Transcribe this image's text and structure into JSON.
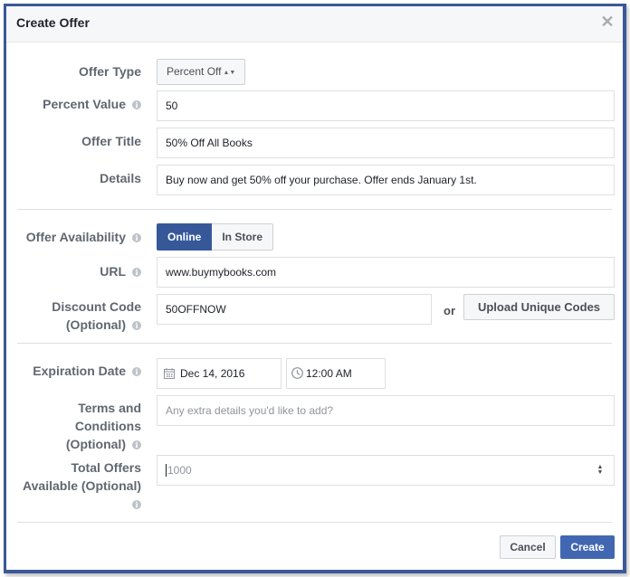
{
  "dialog": {
    "title": "Create Offer",
    "close_icon": "close-icon"
  },
  "form": {
    "offer_type": {
      "label": "Offer Type",
      "value": "Percent Off",
      "icon": "updown-arrows-icon"
    },
    "percent_value": {
      "label": "Percent Value",
      "value": "50",
      "info_icon": "info-icon"
    },
    "offer_title": {
      "label": "Offer Title",
      "value": "50% Off All Books"
    },
    "details": {
      "label": "Details",
      "value": "Buy now and get 50% off your purchase. Offer ends January 1st."
    },
    "offer_availability": {
      "label": "Offer Availability",
      "options": [
        "Online",
        "In Store"
      ],
      "selected": "Online"
    },
    "url": {
      "label": "URL",
      "value": "www.buymybooks.com"
    },
    "discount_code": {
      "label_line1": "Discount Code",
      "label_line2": "(Optional)",
      "value": "50OFFNOW",
      "or_text": "or",
      "upload_button": "Upload Unique Codes"
    },
    "expiration_date": {
      "label": "Expiration Date",
      "date": "Dec 14, 2016",
      "time": "12:00 AM",
      "date_icon": "calendar-icon",
      "time_icon": "clock-icon"
    },
    "terms": {
      "label_line1": "Terms and",
      "label_line2": "Conditions",
      "label_line3": "(Optional)",
      "placeholder": "Any extra details you'd like to add?"
    },
    "total_offers": {
      "label_line1": "Total Offers",
      "label_line2": "Available (Optional)",
      "placeholder": "1000"
    }
  },
  "footer": {
    "cancel_label": "Cancel",
    "create_label": "Create"
  },
  "colors": {
    "accent": "#4267b2",
    "segment_active": "#365899",
    "frame_border": "#3b5998"
  }
}
